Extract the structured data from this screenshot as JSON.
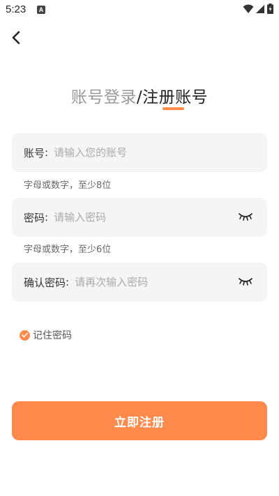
{
  "status_bar": {
    "time": "5:23",
    "notification_badge": "A"
  },
  "header": {
    "tab_login": "账号登录",
    "slash": "/",
    "tab_register": "注册账号"
  },
  "form": {
    "account": {
      "label": "账号",
      "colon": ":",
      "placeholder": "请输入您的账号",
      "value": ""
    },
    "account_hint": "字母或数字，至少8位",
    "password": {
      "label": "密码",
      "colon": ":",
      "placeholder": "请输入密码",
      "value": ""
    },
    "password_hint": "字母或数字，至少6位",
    "confirm": {
      "label": "确认密码",
      "colon": ":",
      "placeholder": "请再次输入密码",
      "value": ""
    },
    "remember_label": "记住密码",
    "remember_checked": true
  },
  "submit_label": "立即注册",
  "colors": {
    "accent": "#ff8a4c",
    "field_bg": "#f5f5f5",
    "placeholder": "#aaaaaa"
  }
}
